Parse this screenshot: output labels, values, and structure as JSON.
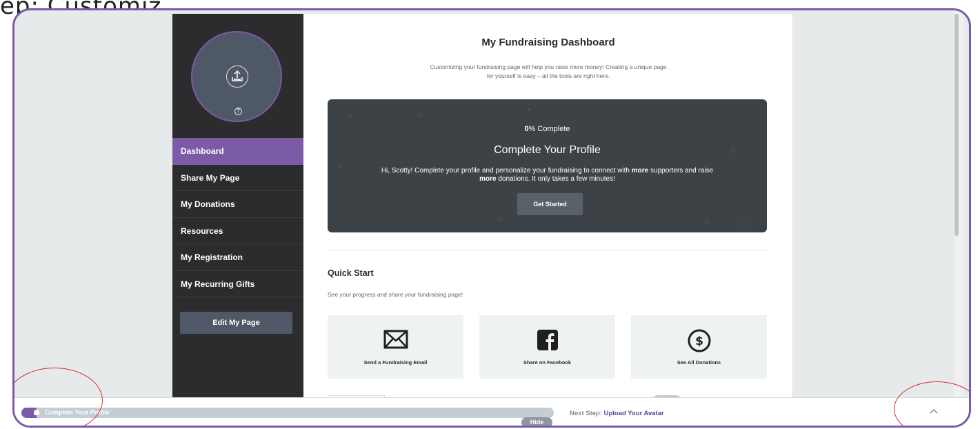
{
  "caption": "ep: Customiz",
  "sidebar": {
    "items": [
      {
        "label": "Dashboard"
      },
      {
        "label": "Share My Page"
      },
      {
        "label": "My Donations"
      },
      {
        "label": "Resources"
      },
      {
        "label": "My Registration"
      },
      {
        "label": "My Recurring Gifts"
      }
    ],
    "edit_button": "Edit My Page",
    "help_glyph": "?"
  },
  "main": {
    "title": "My Fundraising Dashboard",
    "intro_line1": "Customizing your fundraising page will help you raise more money! Creating a unique page",
    "intro_line2": "for yourself is easy – all the tools are right here.",
    "banner": {
      "percent": "0",
      "percent_suffix": "% Complete",
      "progress_fraction": 0,
      "heading": "Complete Your Profile",
      "msg_a": "Hi, Scotty! Complete your profile and personalize your fundraising to connect with ",
      "msg_b": "more",
      "msg_c": " supporters and raise",
      "msg_d": "more",
      "msg_e": " donations. It only takes a few minutes!",
      "button": "Get Started"
    },
    "quick_start": {
      "title": "Quick Start",
      "subtitle": "See your progress and share your fundraising page!",
      "cards": [
        {
          "label": "Send a Fundraising Email",
          "icon": "envelope-icon"
        },
        {
          "label": "Share on Facebook",
          "icon": "facebook-icon"
        },
        {
          "label": "See All Donations",
          "icon": "dollar-icon"
        }
      ]
    }
  },
  "bottom_bar": {
    "progress_label": "Complete Your Profile",
    "hide": "Hide",
    "next_prefix": "Next Step: ",
    "next_step": "Upload Your Avatar"
  },
  "colors": {
    "accent": "#7b5aa6",
    "sidebar_bg": "#2c2c2e",
    "banner_bg": "#3d4247",
    "annotation": "#d62b2b"
  }
}
